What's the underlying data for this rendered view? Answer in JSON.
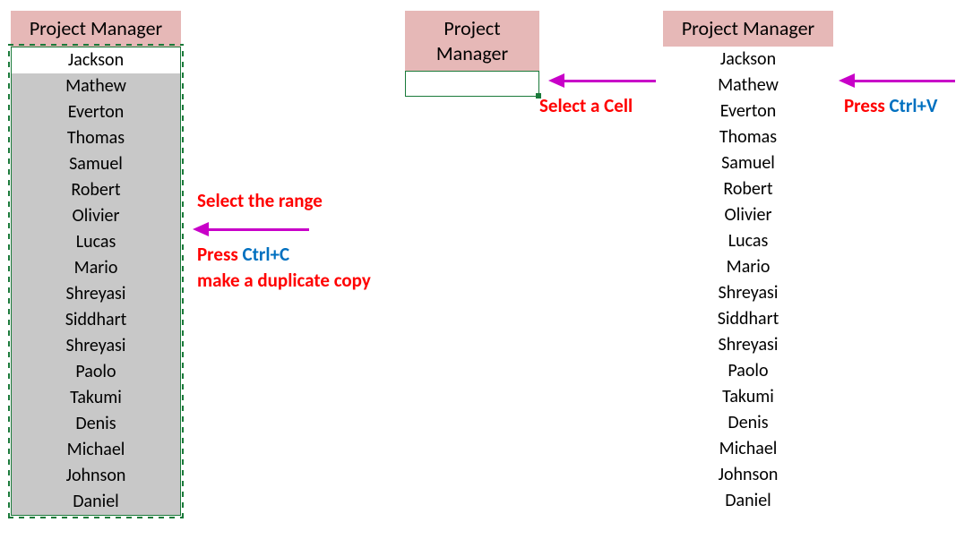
{
  "header": "Project Manager",
  "names": [
    "Jackson",
    "Mathew",
    "Everton",
    "Thomas",
    "Samuel",
    "Robert",
    "Olivier",
    "Lucas",
    "Mario",
    "Shreyasi",
    "Siddhart",
    "Shreyasi",
    "Paolo",
    "Takumi",
    "Denis",
    "Michael",
    "Johnson",
    "Daniel"
  ],
  "anno1": {
    "line1": "Select the range",
    "line2a": "Press ",
    "line2b": "Ctrl+C",
    "line3": "make a duplicate copy"
  },
  "anno2": "Select a Cell",
  "anno3": {
    "a": "Press ",
    "b": "Ctrl+V"
  }
}
